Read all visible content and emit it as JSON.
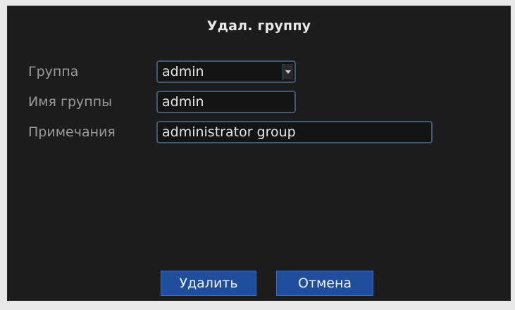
{
  "dialog": {
    "title": "Удал. группу",
    "fields": {
      "group": {
        "label": "Группа",
        "value": "admin"
      },
      "group_name": {
        "label": "Имя группы",
        "value": "admin"
      },
      "notes": {
        "label": "Примечания",
        "value": "administrator group"
      }
    },
    "buttons": {
      "delete": "Удалить",
      "cancel": "Отмена"
    }
  },
  "colors": {
    "background": "#1c1c1c",
    "field_border": "#3d5a78",
    "button": "#1f4f9c",
    "label_text": "#9a9a9a",
    "value_text": "#e6e6e6"
  },
  "icons": {
    "dropdown": "chevron-down-icon"
  }
}
